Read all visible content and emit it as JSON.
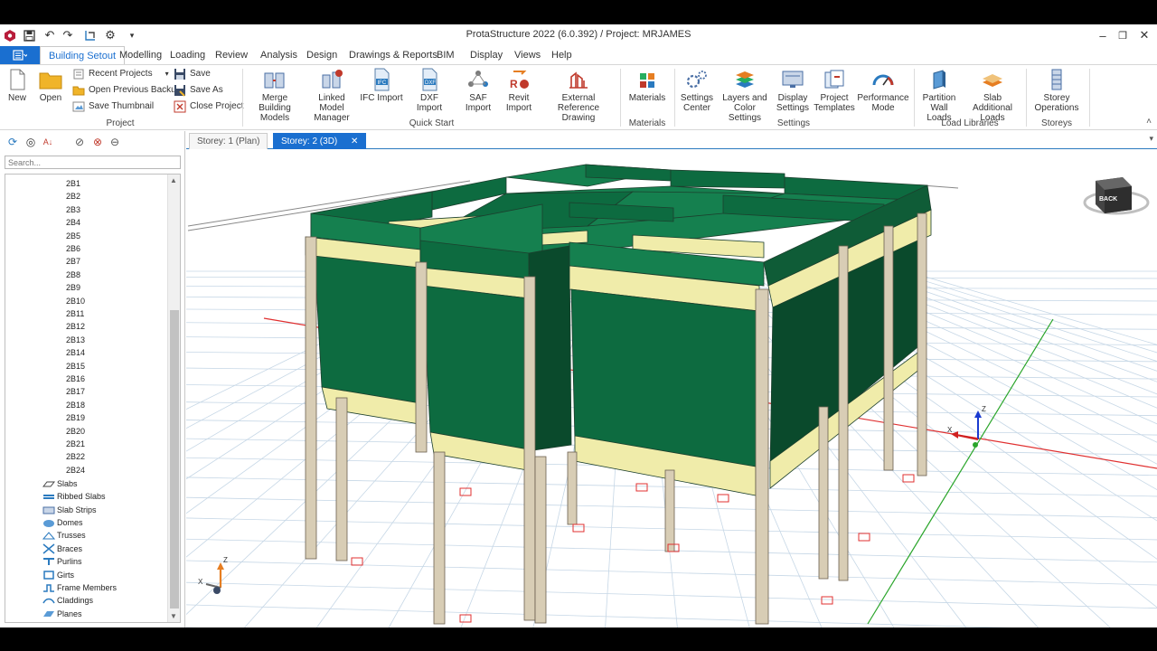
{
  "app": {
    "title": "ProtaStructure 2022 (6.0.392) / Project: MRJAMES",
    "file_menu_label": "",
    "window_controls": [
      "minimize",
      "restore",
      "close"
    ]
  },
  "ribbon_tabs": [
    "Building Setout",
    "Modelling",
    "Loading",
    "Review",
    "Analysis",
    "Design",
    "Drawings & Reports",
    "BIM",
    "Display",
    "Views",
    "Help"
  ],
  "active_tab": "Building Setout",
  "ribbon": {
    "project": {
      "label": "Project",
      "new": "New",
      "open": "Open",
      "recent": "Recent Projects",
      "open_backup": "Open Previous Backup",
      "save_thumb": "Save Thumbnail",
      "save": "Save",
      "save_as": "Save As",
      "close": "Close Project"
    },
    "quick_start": {
      "label": "Quick Start",
      "merge": [
        "Merge Building",
        "Models"
      ],
      "linked": [
        "Linked Model",
        "Manager"
      ],
      "ifc": "IFC Import",
      "dxf": "DXF Import",
      "saf": "SAF Import",
      "revit": [
        "Revit",
        "Import"
      ],
      "external": [
        "External",
        "Reference Drawing"
      ]
    },
    "materials": {
      "label": "Materials",
      "btn": "Materials"
    },
    "settings": {
      "label": "Settings",
      "center": [
        "Settings",
        "Center"
      ],
      "layers": [
        "Layers and",
        "Color Settings"
      ],
      "display": [
        "Display",
        "Settings"
      ],
      "templates": [
        "Project",
        "Templates"
      ],
      "perf": [
        "Performance",
        "Mode"
      ]
    },
    "load_libraries": {
      "label": "Load Libraries",
      "partition": [
        "Partition",
        "Wall Loads"
      ],
      "slab": [
        "Slab Additional",
        "Loads"
      ]
    },
    "storeys": {
      "label": "Storeys",
      "ops": [
        "Storey",
        "Operations"
      ]
    }
  },
  "left_panel": {
    "search_placeholder": "Search...",
    "beams": [
      "2B1",
      "2B2",
      "2B3",
      "2B4",
      "2B5",
      "2B6",
      "2B7",
      "2B8",
      "2B9",
      "2B10",
      "2B11",
      "2B12",
      "2B13",
      "2B14",
      "2B15",
      "2B16",
      "2B17",
      "2B18",
      "2B19",
      "2B20",
      "2B21",
      "2B22",
      "2B24"
    ],
    "categories": [
      "Slabs",
      "Ribbed Slabs",
      "Slab Strips",
      "Domes",
      "Trusses",
      "Braces",
      "Purlins",
      "Girts",
      "Frame Members",
      "Claddings",
      "Planes"
    ]
  },
  "view_tabs": [
    {
      "label": "Storey: 1 (Plan)",
      "active": false
    },
    {
      "label": "Storey: 2 (3D)",
      "active": true,
      "closable": true
    }
  ],
  "viewport": {
    "nav_cube_label": "BACK",
    "axes": {
      "x": "X",
      "z": "Z"
    }
  },
  "colors": {
    "accent": "#1a6fd0",
    "wall_front": "#0d6b40",
    "wall_top": "#15804f",
    "beam_yellow": "#f0ecaa",
    "column": "#d8cdb5",
    "grid": "#c6d7e6"
  }
}
